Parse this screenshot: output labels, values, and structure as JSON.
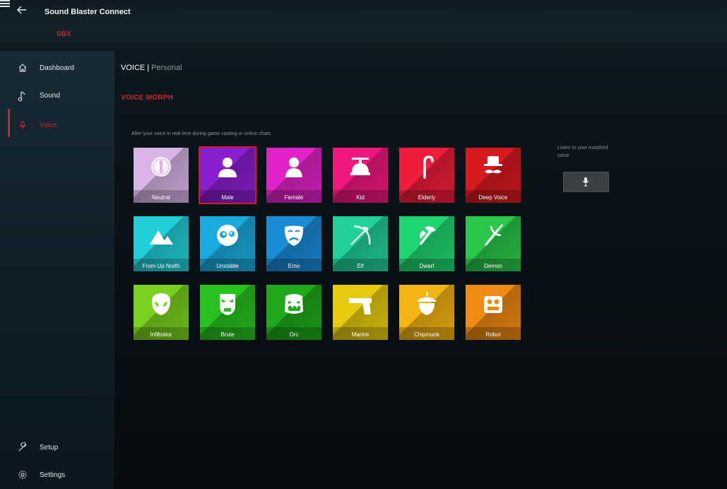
{
  "app": {
    "title": "Sound Blaster Connect",
    "device": "SBX",
    "accent": "#c9252b"
  },
  "sidebar": {
    "items": [
      {
        "label": "Dashboard",
        "icon": "home-icon"
      },
      {
        "label": "Sound",
        "icon": "music-note-icon"
      },
      {
        "label": "Voice",
        "icon": "microphone-icon",
        "active": true
      }
    ],
    "bottom": [
      {
        "label": "Setup",
        "icon": "wrench-icon"
      },
      {
        "label": "Settings",
        "icon": "gear-icon"
      }
    ]
  },
  "main": {
    "breadcrumb": {
      "section": "VOICE",
      "separator": "|",
      "page": "Personal"
    },
    "section_title": "VOICE MORPH",
    "description": "Alter your voice in real time during game casting or online chats.",
    "presets": [
      {
        "label": "Neutral",
        "icon": "neutral-icon",
        "color": "#d8b5e6"
      },
      {
        "label": "Male",
        "icon": "male-icon",
        "color": "#8a1fd0",
        "selected": true
      },
      {
        "label": "Female",
        "icon": "female-icon",
        "color": "#e022c7"
      },
      {
        "label": "Kid",
        "icon": "propeller-hat-icon",
        "color": "#f0187f"
      },
      {
        "label": "Elderly",
        "icon": "cane-icon",
        "color": "#ef1d3a"
      },
      {
        "label": "Deep Voice",
        "icon": "mustache-hat-icon",
        "color": "#d71920"
      },
      {
        "label": "From Up North",
        "icon": "mountains-icon",
        "color": "#22cfd8"
      },
      {
        "label": "Unstable",
        "icon": "crazy-eyes-icon",
        "color": "#1aabdf"
      },
      {
        "label": "Emo",
        "icon": "drama-mask-icon",
        "color": "#1a8bd6"
      },
      {
        "label": "Elf",
        "icon": "bow-arrow-icon",
        "color": "#22d19a"
      },
      {
        "label": "Dwarf",
        "icon": "axe-icon",
        "color": "#1fd771"
      },
      {
        "label": "Demon",
        "icon": "trident-icon",
        "color": "#2ac84a"
      },
      {
        "label": "Infiltrator",
        "icon": "alien-icon",
        "color": "#7bd21e"
      },
      {
        "label": "Brute",
        "icon": "brute-mask-icon",
        "color": "#27c21d"
      },
      {
        "label": "Orc",
        "icon": "orc-face-icon",
        "color": "#1eaa1a"
      },
      {
        "label": "Marine",
        "icon": "pistol-icon",
        "color": "#e7cb0f"
      },
      {
        "label": "Chipmunk",
        "icon": "acorn-icon",
        "color": "#f4b411"
      },
      {
        "label": "Robot",
        "icon": "robot-head-icon",
        "color": "#ef8a12"
      }
    ],
    "listen_text": "Listen to your morphed voice",
    "mic_button_icon": "microphone-icon"
  }
}
